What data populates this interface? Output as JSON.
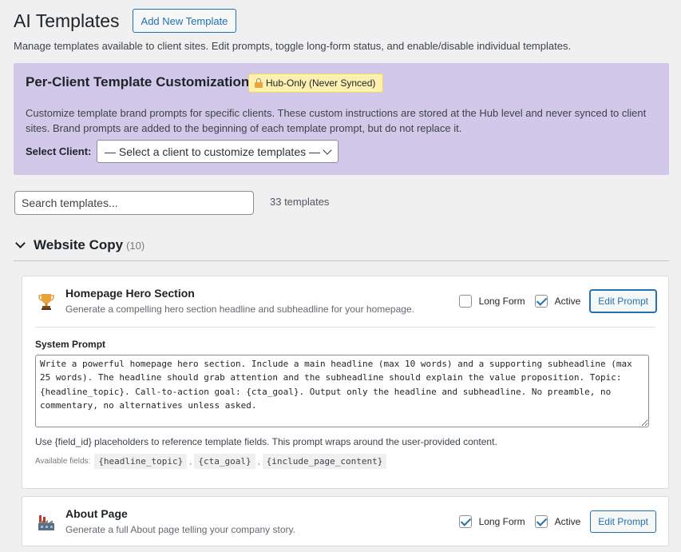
{
  "header": {
    "title": "AI Templates",
    "add_button": "Add New Template",
    "subtitle": "Manage templates available to client sites. Edit prompts, toggle long-form status, and enable/disable individual templates."
  },
  "customization": {
    "title": "Per-Client Template Customization",
    "badge": "Hub-Only (Never Synced)",
    "description": "Customize template brand prompts for specific clients. These custom instructions are stored at the Hub level and never synced to client sites. Brand prompts are added to the beginning of each template prompt, but do not replace it.",
    "select_label": "Select Client:",
    "select_value": "— Select a client to customize templates —"
  },
  "search": {
    "placeholder": "Search templates...",
    "count_text": "33 templates"
  },
  "section": {
    "title": "Website Copy",
    "count": "(10)"
  },
  "templates": [
    {
      "title": "Homepage Hero Section",
      "icon": "trophy-icon",
      "description": "Generate a compelling hero section headline and subheadline for your homepage.",
      "long_form_label": "Long Form",
      "long_form": false,
      "active_label": "Active",
      "active": true,
      "edit_label": "Edit Prompt",
      "prompt_label": "System Prompt",
      "prompt": "Write a powerful homepage hero section. Include a main headline (max 10 words) and a supporting subheadline (max 25 words). The headline should grab attention and the subheadline should explain the value proposition. Topic: {headline_topic}. Call-to-action goal: {cta_goal}. Output only the headline and subheadline. No preamble, no commentary, no alternatives unless asked.",
      "help": "Use {field_id} placeholders to reference template fields. This prompt wraps around the user-provided content.",
      "available_label": "Available fields:",
      "fields": [
        "{headline_topic}",
        "{cta_goal}",
        "{include_page_content}"
      ],
      "field_sep": ","
    },
    {
      "title": "About Page",
      "icon": "factory-icon",
      "description": "Generate a full About page telling your company story.",
      "long_form_label": "Long Form",
      "long_form": true,
      "active_label": "Active",
      "active": true,
      "edit_label": "Edit Prompt"
    }
  ],
  "colors": {
    "accent": "#2271b1",
    "panel_purple": "#d2c8ea",
    "badge_yellow": "#fdf0b0"
  }
}
